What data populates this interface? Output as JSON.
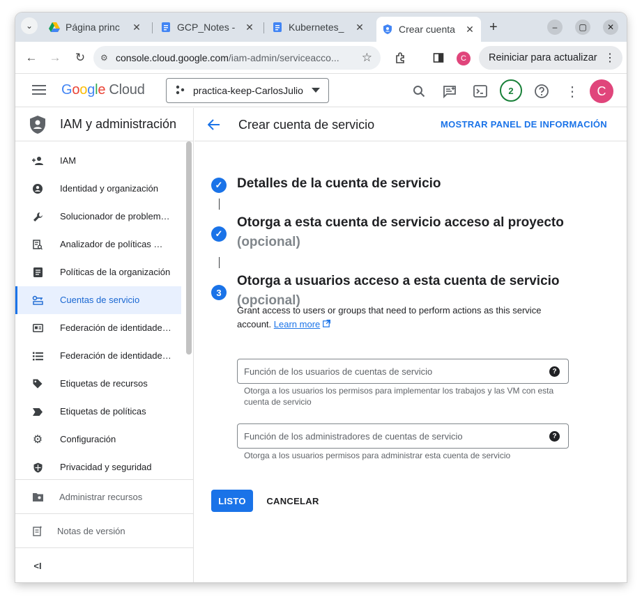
{
  "browser": {
    "tabs": [
      {
        "label": "Página princ",
        "icon": "google-drive-icon"
      },
      {
        "label": "GCP_Notes - ",
        "icon": "google-docs-icon"
      },
      {
        "label": "Kubernetes_",
        "icon": "google-docs-icon"
      },
      {
        "label": "Crear cuenta",
        "icon": "gcp-shield-icon",
        "active": true
      }
    ],
    "url_host": "console.cloud.google.com",
    "url_path": "/iam-admin/serviceacco...",
    "profile_initial": "C",
    "update_label": "Reiniciar para actualizar"
  },
  "gcp_header": {
    "logo_text": "Google",
    "logo_suffix": "Cloud",
    "project": "practica-keep-CarlosJulio",
    "notifications_count": "2",
    "avatar_initial": "C"
  },
  "sidebar": {
    "title": "IAM y administración",
    "items": [
      {
        "label": "IAM",
        "icon": "person-add-icon"
      },
      {
        "label": "Identidad y organización",
        "icon": "account-circle-icon"
      },
      {
        "label": "Solucionador de problem…",
        "icon": "wrench-icon"
      },
      {
        "label": "Analizador de políticas …",
        "icon": "policy-analyzer-icon"
      },
      {
        "label": "Políticas de la organización",
        "icon": "document-icon"
      },
      {
        "label": "Cuentas de servicio",
        "icon": "service-account-icon",
        "active": true
      },
      {
        "label": "Federación de identidade…",
        "icon": "id-card-icon"
      },
      {
        "label": "Federación de identidade…",
        "icon": "list-icon"
      },
      {
        "label": "Etiquetas de recursos",
        "icon": "tag-icon"
      },
      {
        "label": "Etiquetas de políticas",
        "icon": "label-icon"
      },
      {
        "label": "Configuración",
        "icon": "gear-icon"
      },
      {
        "label": "Privacidad y seguridad",
        "icon": "shield-icon"
      }
    ],
    "manage_resources": "Administrar recursos",
    "release_notes": "Notas de versión",
    "collapse_label": "<I"
  },
  "main": {
    "title": "Crear cuenta de servicio",
    "info_panel_link": "MOSTRAR PANEL DE INFORMACIÓN",
    "steps": [
      {
        "title": "Detalles de la cuenta de servicio",
        "status": "done"
      },
      {
        "title": "Otorga a esta cuenta de servicio acceso al proyecto",
        "subtitle": "(opcional)",
        "status": "done"
      },
      {
        "number": "3",
        "title": "Otorga a usuarios acceso a esta cuenta de servicio",
        "subtitle": "(opcional)",
        "status": "current"
      }
    ],
    "description": "Grant access to users or groups that need to perform actions as this service account.",
    "learn_more": "Learn more",
    "fields": [
      {
        "placeholder": "Función de los usuarios de cuentas de servicio",
        "hint": "Otorga a los usuarios los permisos para implementar los trabajos y las VM con esta cuenta de servicio"
      },
      {
        "placeholder": "Función de los administradores de cuentas de servicio",
        "hint": "Otorga a los usuarios permisos para administrar esta cuenta de servicio"
      }
    ],
    "done_button": "LISTO",
    "cancel_button": "CANCELAR"
  },
  "colors": {
    "accent": "#1a73e8",
    "avatar": "#e0457b",
    "notification_ring": "#188038"
  }
}
